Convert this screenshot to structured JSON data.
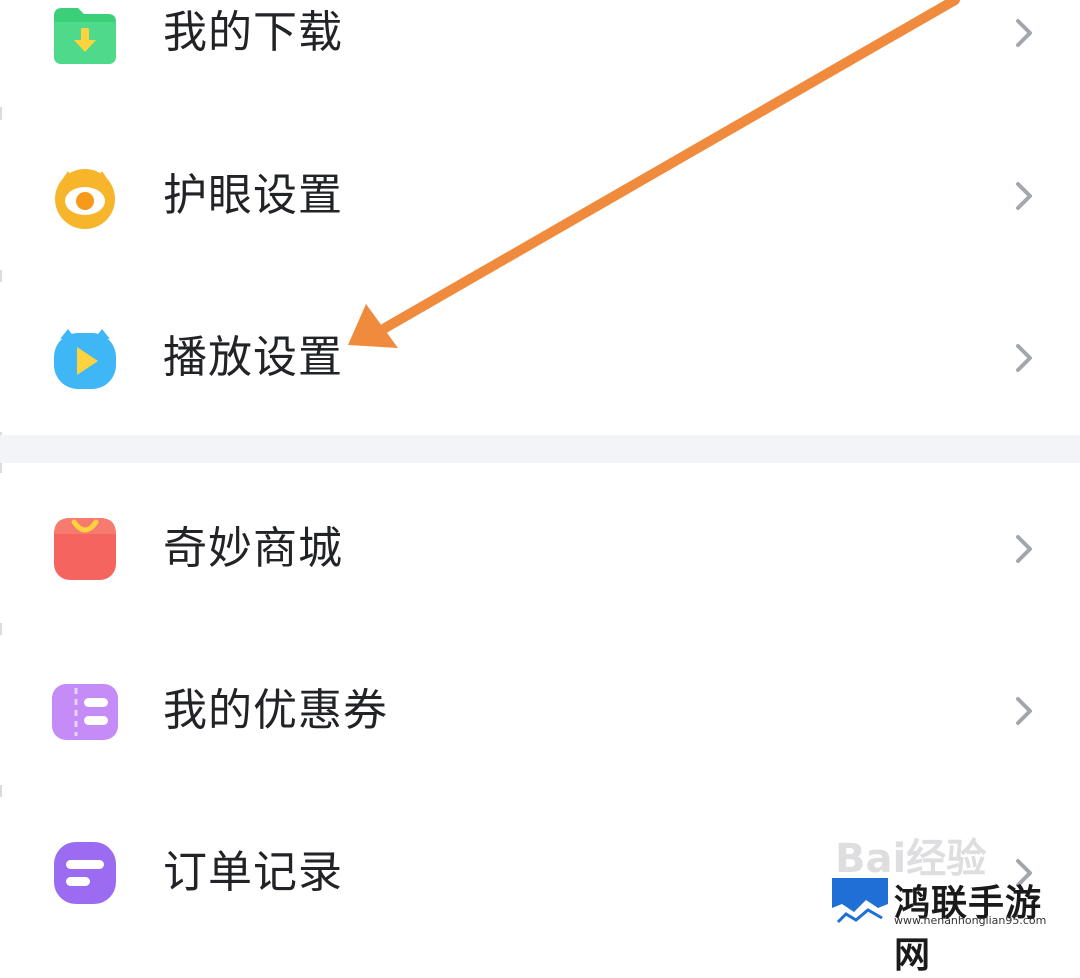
{
  "menu": {
    "items": [
      {
        "label": "我的下载",
        "icon": "download-folder-icon",
        "color": "#3ccf7a"
      },
      {
        "label": "护眼设置",
        "icon": "eye-protection-icon",
        "color": "#f7b52b"
      },
      {
        "label": "播放设置",
        "icon": "play-settings-icon",
        "color": "#3fb6f5"
      },
      {
        "label": "奇妙商城",
        "icon": "shopping-bag-icon",
        "color": "#f5645e"
      },
      {
        "label": "我的优惠券",
        "icon": "coupon-icon",
        "color": "#c58cf7"
      },
      {
        "label": "订单记录",
        "icon": "order-record-icon",
        "color": "#9b6cf2"
      }
    ]
  },
  "annotation": {
    "arrow_color": "#f08a3c"
  },
  "watermark": {
    "baidu": "Bai经验",
    "brand_name": "鸿联手游网",
    "brand_url": "www.henanhonglian95.com"
  }
}
